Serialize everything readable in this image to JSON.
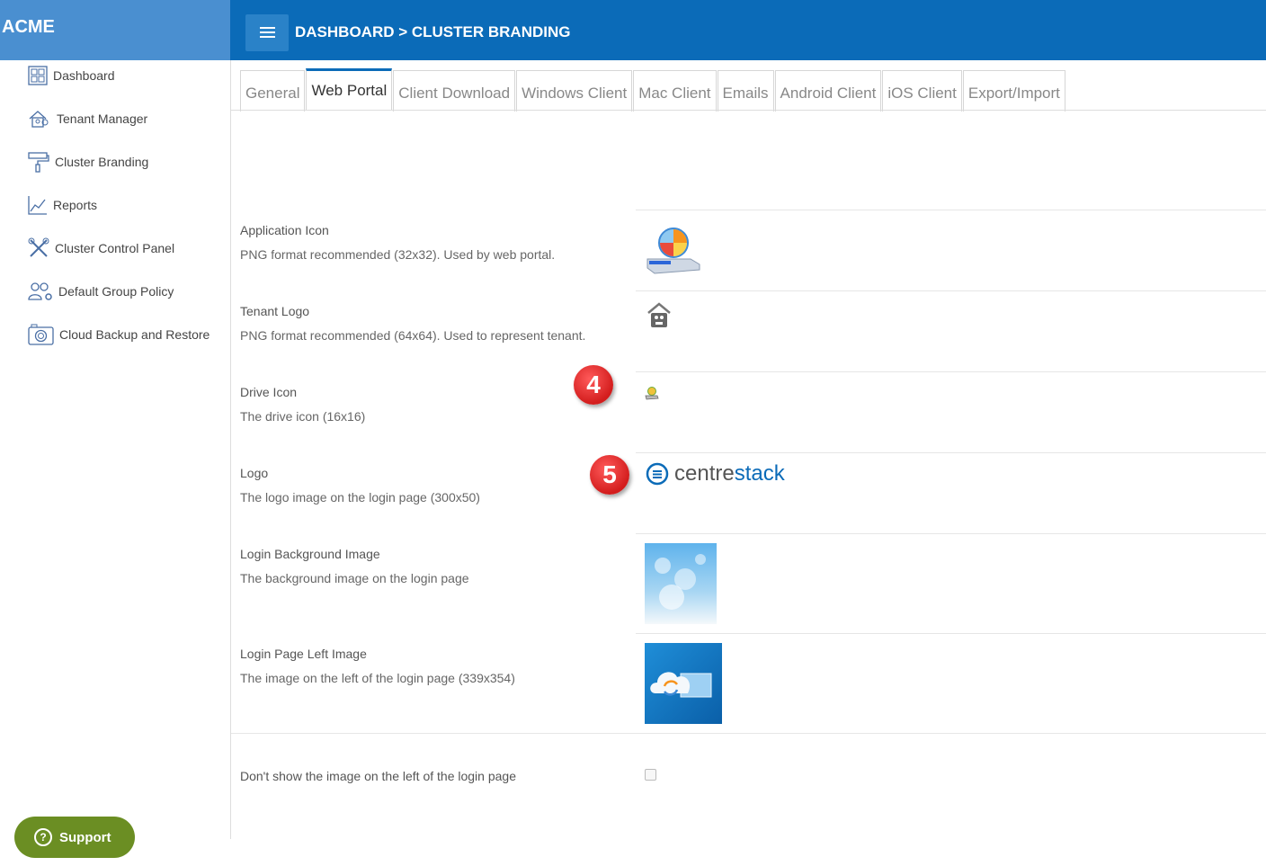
{
  "brand": {
    "name": "ACME"
  },
  "header": {
    "breadcrumb": "DASHBOARD > CLUSTER BRANDING"
  },
  "sidebar": {
    "items": [
      {
        "label": "Dashboard",
        "icon": "dashboard-icon"
      },
      {
        "label": "Tenant Manager",
        "icon": "tenant-manager-icon"
      },
      {
        "label": "Cluster Branding",
        "icon": "paint-roller-icon"
      },
      {
        "label": "Reports",
        "icon": "chart-icon"
      },
      {
        "label": "Cluster Control Panel",
        "icon": "tools-icon"
      },
      {
        "label": "Default Group Policy",
        "icon": "users-gear-icon"
      },
      {
        "label": "Cloud Backup and Restore",
        "icon": "camera-icon"
      }
    ],
    "support_label": "Support"
  },
  "tabs": [
    {
      "label": "General",
      "active": false
    },
    {
      "label": "Web Portal",
      "active": true
    },
    {
      "label": "Client Download",
      "active": false
    },
    {
      "label": "Windows Client",
      "active": false
    },
    {
      "label": "Mac Client",
      "active": false
    },
    {
      "label": "Emails",
      "active": false
    },
    {
      "label": "Android Client",
      "active": false
    },
    {
      "label": "iOS Client",
      "active": false
    },
    {
      "label": "Export/Import",
      "active": false
    }
  ],
  "settings": [
    {
      "label": "Application Icon",
      "desc": "PNG format recommended (32x32). Used by web portal."
    },
    {
      "label": "Tenant Logo",
      "desc": "PNG format recommended (64x64). Used to represent tenant."
    },
    {
      "label": "Drive Icon",
      "desc": "The drive icon (16x16)",
      "badge": "4"
    },
    {
      "label": "Logo",
      "desc": "The logo image on the login page (300x50)",
      "badge": "5",
      "logo_text_a": "centre",
      "logo_text_b": "stack"
    },
    {
      "label": "Login Background Image",
      "desc": "The background image on the login page"
    },
    {
      "label": "Login Page Left Image",
      "desc": "The image on the left of the login page (339x354)"
    }
  ],
  "hide_left_image": {
    "label": "Don't show the image on the left of the login page",
    "checked": false
  },
  "colors": {
    "header": "#0b6bb8",
    "brand": "#4a8fd0",
    "support": "#6b8e23",
    "badge": "#d31d1d"
  }
}
